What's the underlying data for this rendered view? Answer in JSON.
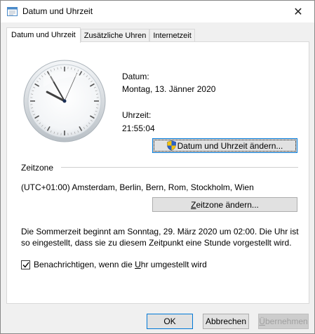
{
  "window": {
    "title": "Datum und Uhrzeit",
    "close_glyph": "✕"
  },
  "tabs": [
    {
      "label": "Datum und Uhrzeit",
      "active": true
    },
    {
      "label": "Zusätzliche Uhren",
      "active": false
    },
    {
      "label": "Internetzeit",
      "active": false
    }
  ],
  "date": {
    "label": "Datum:",
    "value": "Montag, 13. Jänner 2020"
  },
  "time": {
    "label": "Uhrzeit:",
    "value": "21:55:04",
    "hour": 21,
    "minute": 55,
    "second": 4
  },
  "change_datetime_button": {
    "label": "Datum und Uhrzeit ändern...",
    "icon": "uac-shield-icon"
  },
  "timezone": {
    "heading": "Zeitzone",
    "value": "(UTC+01:00) Amsterdam, Berlin, Bern, Rom, Stockholm, Wien",
    "button_label_pre": "",
    "button_underline": "Z",
    "button_label_post": "eitzone ändern..."
  },
  "dst_note": "Die Sommerzeit beginnt am Sonntag, 29. März 2020 um 02:00. Die Uhr ist so eingestellt, dass sie zu diesem Zeitpunkt eine Stunde vorgestellt wird.",
  "notify": {
    "checked": true,
    "label_pre": "Benachrichtigen, wenn die ",
    "label_underline": "U",
    "label_post": "hr umgestellt wird"
  },
  "footer": {
    "ok_label": "OK",
    "cancel_label": "Abbrechen",
    "apply_underline": "Ü",
    "apply_post": "bernehmen"
  },
  "colors": {
    "accent": "#0078d7",
    "disabled_text": "#a0a0a0"
  }
}
